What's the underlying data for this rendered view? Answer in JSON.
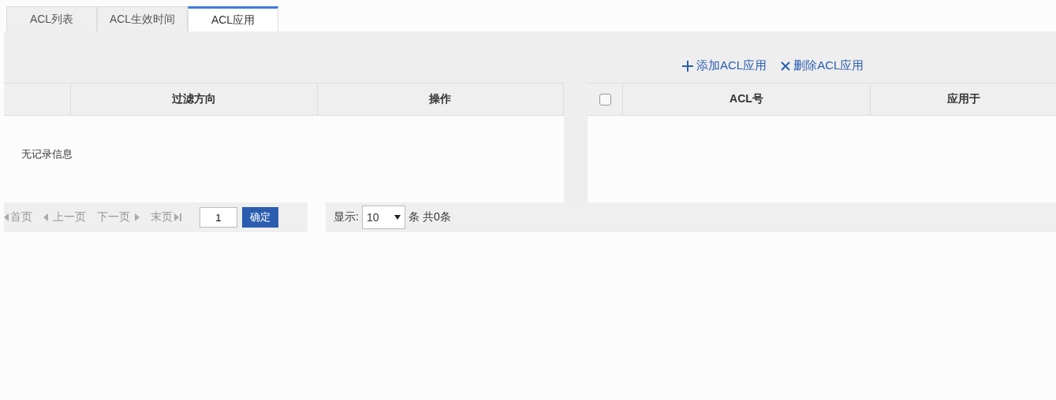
{
  "tabs": [
    {
      "label": "ACL列表",
      "selected": false
    },
    {
      "label": "ACL生效时间",
      "selected": false
    },
    {
      "label": "ACL应用",
      "selected": true
    }
  ],
  "left_table": {
    "columns": [
      "过滤方向",
      "操作"
    ],
    "empty_message": "无记录信息"
  },
  "toolbar": {
    "buttons": [
      {
        "label": "添加ACL应用",
        "kind": "add"
      },
      {
        "label": "删除ACL应用",
        "kind": "delete"
      }
    ]
  },
  "right_table": {
    "select_all": {
      "checked": false
    },
    "columns": [
      "ACL号",
      "应用于"
    ]
  },
  "pager": {
    "first": "首页",
    "prev": "上一页",
    "next": "下一页",
    "last": "末页",
    "page": "1",
    "go": "确定",
    "show_label": "显示:",
    "page_size": "10",
    "unit": "条",
    "total": "共0条"
  }
}
